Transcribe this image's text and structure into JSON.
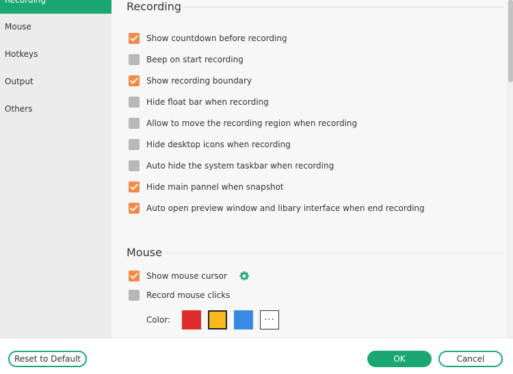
{
  "sidebar": {
    "items": [
      {
        "label": "Recording",
        "active": true
      },
      {
        "label": "Mouse",
        "active": false
      },
      {
        "label": "Hotkeys",
        "active": false
      },
      {
        "label": "Output",
        "active": false
      },
      {
        "label": "Others",
        "active": false
      }
    ]
  },
  "recording": {
    "title": "Recording",
    "options": [
      {
        "label": "Show countdown before recording",
        "checked": true
      },
      {
        "label": "Beep on start recording",
        "checked": false
      },
      {
        "label": "Show recording boundary",
        "checked": true
      },
      {
        "label": "Hide float bar when recording",
        "checked": false
      },
      {
        "label": "Allow to move the recording region when recording",
        "checked": false
      },
      {
        "label": "Hide desktop icons when recording",
        "checked": false
      },
      {
        "label": "Auto hide the system taskbar when recording",
        "checked": false
      },
      {
        "label": "Hide main pannel when snapshot",
        "checked": true
      },
      {
        "label": "Auto open preview window and libary interface when end recording",
        "checked": true
      }
    ]
  },
  "mouse": {
    "title": "Mouse",
    "show_cursor": {
      "label": "Show mouse cursor",
      "checked": true
    },
    "record_clicks": {
      "label": "Record mouse clicks",
      "checked": false
    },
    "color_label": "Color:",
    "colors": [
      {
        "name": "red",
        "hex": "#e02b2b",
        "selected": false
      },
      {
        "name": "yellow",
        "hex": "#f9b81d",
        "selected": true
      },
      {
        "name": "blue",
        "hex": "#3b8ae2",
        "selected": false
      }
    ],
    "more_label": "···"
  },
  "footer": {
    "reset_label": "Reset to Default",
    "ok_label": "OK",
    "cancel_label": "Cancel"
  },
  "theme": {
    "accent": "#1aa774",
    "checkbox_on": "#f28a46",
    "checkbox_off": "#b8b8b8"
  }
}
